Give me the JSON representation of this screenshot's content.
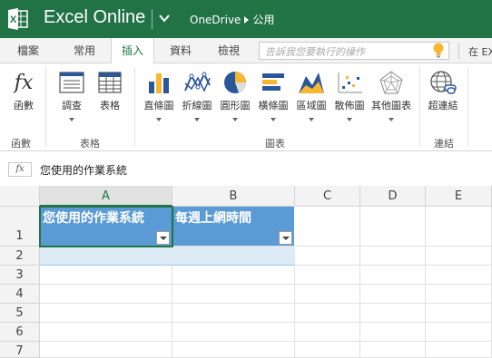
{
  "titlebar": {
    "app_title": "Excel Online",
    "crumb_root": "OneDrive",
    "crumb_folder": "公用"
  },
  "tabs": {
    "file": "檔案",
    "home": "常用",
    "insert": "插入",
    "data": "資料",
    "review": "檢視",
    "tellme_placeholder": "告訴我您要執行的操作",
    "open_in_excel": "在 EX"
  },
  "ribbon": {
    "function_btn": "函數",
    "survey_btn": "調查",
    "table_btn": "表格",
    "column_chart_btn": "直條圖",
    "line_chart_btn": "折線圖",
    "pie_chart_btn": "圓形圖",
    "bar_chart_btn": "橫條圖",
    "area_chart_btn": "區域圖",
    "scatter_chart_btn": "散佈圖",
    "other_chart_btn": "其他圖表",
    "hyperlink_btn": "超連結",
    "group_functions": "函數",
    "group_tables": "表格",
    "group_charts": "圖表",
    "group_links": "連結"
  },
  "formula_bar": {
    "fx_label": "fx",
    "value": "您使用的作業系統"
  },
  "sheet": {
    "columns": [
      "A",
      "B",
      "C",
      "D",
      "E"
    ],
    "rows": [
      "1",
      "2",
      "3",
      "4",
      "5",
      "6",
      "7"
    ],
    "cells": {
      "A1": "您使用的作業系統",
      "B1": "每週上網時間"
    }
  },
  "colors": {
    "brand": "#217346",
    "table_header": "#5b9bd5",
    "table_band": "#ddebf7"
  }
}
